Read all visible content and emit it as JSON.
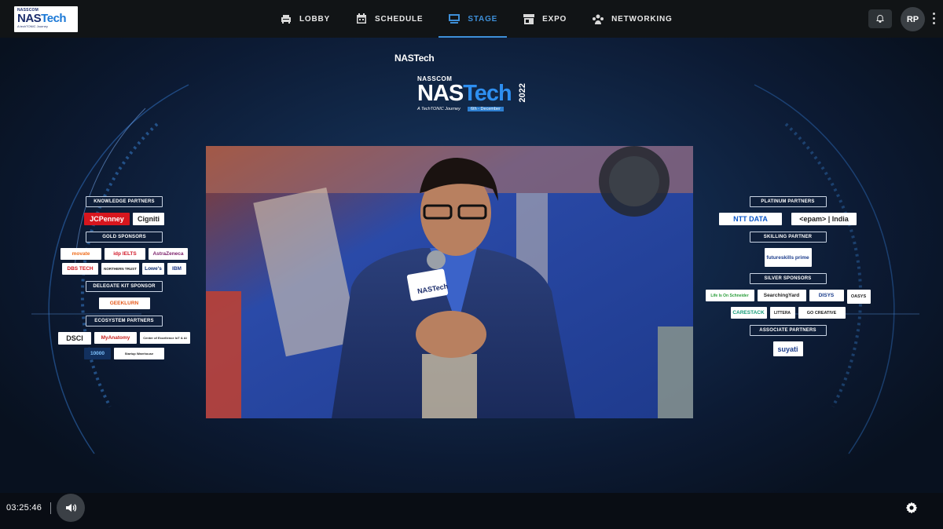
{
  "header": {
    "logo": {
      "line1": "NASSCOM",
      "line2a": "NAS",
      "line2b": "Tech",
      "line3": "A techTONIC Journey"
    },
    "nav": [
      {
        "label": "LOBBY",
        "icon": "sofa-icon"
      },
      {
        "label": "SCHEDULE",
        "icon": "calendar-icon"
      },
      {
        "label": "STAGE",
        "icon": "stage-icon",
        "active": true
      },
      {
        "label": "EXPO",
        "icon": "shop-icon"
      },
      {
        "label": "NETWORKING",
        "icon": "people-icon"
      }
    ],
    "notifications_icon": "bell-icon",
    "avatar_initials": "RP",
    "more_icon": "vertical-dots-icon"
  },
  "stage": {
    "title": "NASTech",
    "event_logo": {
      "top": "NASSCOM",
      "name_a": "NAS",
      "name_b": "Tech",
      "year": "2022",
      "tagline": "A TechTONIC Journey",
      "date": "6th - December"
    },
    "video": {
      "mic_label": "NASTech",
      "brand_color": "#2a4ca6"
    },
    "left_panel": [
      {
        "category": "KNOWLEDGE PARTNERS",
        "logos": [
          "JCPenney",
          "Cigniti"
        ]
      },
      {
        "category": "GOLD SPONSORS",
        "logos": [
          "movate",
          "idp IELTS",
          "AstraZeneca",
          "DBS TECH",
          "NORTHERN TRUST",
          "Lowe's",
          "IBM"
        ]
      },
      {
        "category": "DELEGATE KIT SPONSOR",
        "logos": [
          "GEEKLURN"
        ]
      },
      {
        "category": "ECOSYSTEM PARTNERS",
        "logos": [
          "DSCI",
          "MyAnatomy",
          "Center of Excellence IoT & AI",
          "10000",
          "Startup Warehouse"
        ]
      }
    ],
    "right_panel": [
      {
        "category": "PLATINUM PARTNERS",
        "logos": [
          "NTT DATA",
          "<epam> | India"
        ]
      },
      {
        "category": "SKILLING PARTNER",
        "logos": [
          "futureskills prime"
        ]
      },
      {
        "category": "SILVER SPONSORS",
        "logos": [
          "Life Is On Schneider",
          "SearchingYard",
          "DISYS",
          "OASYS",
          "CARESTACK",
          "LITTERA",
          "GO CREATIVE"
        ]
      },
      {
        "category": "ASSOCIATE PARTNERS",
        "logos": [
          "suyati"
        ]
      }
    ]
  },
  "player": {
    "time": "03:25:46",
    "volume_icon": "speaker-icon",
    "settings_icon": "gear-icon"
  }
}
